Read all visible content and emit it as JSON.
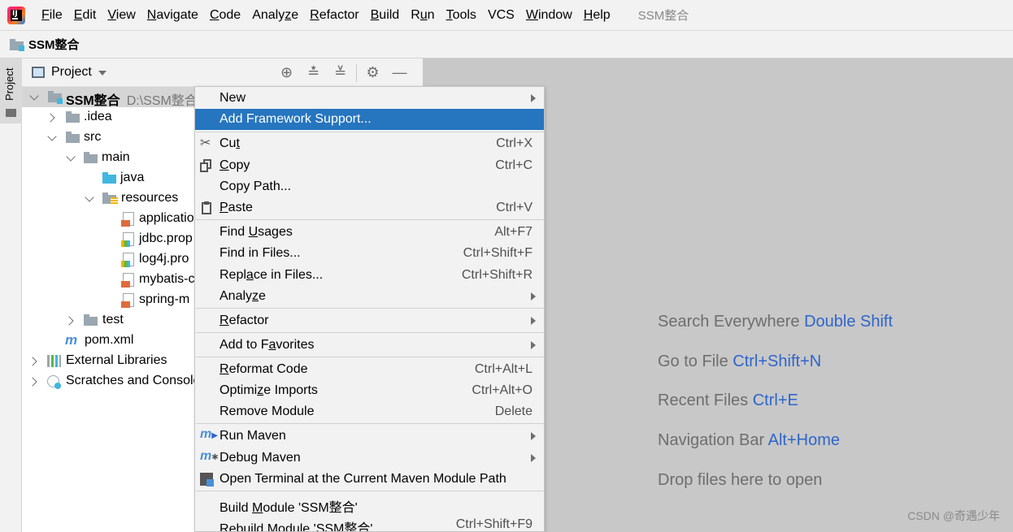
{
  "menubar": {
    "items": [
      "File",
      "Edit",
      "View",
      "Navigate",
      "Code",
      "Analyze",
      "Refactor",
      "Build",
      "Run",
      "Tools",
      "VCS",
      "Window",
      "Help"
    ],
    "title": "SSM整合"
  },
  "navbar": {
    "title": "SSM整合"
  },
  "sidestrip": {
    "tab_label": "Project"
  },
  "panel": {
    "title": "Project",
    "tree": [
      {
        "label": "SSM整合",
        "path": "D:\\SSM整合"
      },
      {
        "label": ".idea"
      },
      {
        "label": "src"
      },
      {
        "label": "main"
      },
      {
        "label": "java"
      },
      {
        "label": "resources"
      },
      {
        "label": "applicatio"
      },
      {
        "label": "jdbc.prop"
      },
      {
        "label": "log4j.pro"
      },
      {
        "label": "mybatis-c"
      },
      {
        "label": "spring-m"
      },
      {
        "label": "test"
      },
      {
        "label": "pom.xml"
      },
      {
        "label": "External Libraries"
      },
      {
        "label": "Scratches and Consoles"
      }
    ]
  },
  "context_menu": {
    "items": [
      {
        "label": "New",
        "shortcut": ""
      },
      {
        "label": "Add Framework Support...",
        "shortcut": ""
      },
      {
        "label": "Cut",
        "shortcut": "Ctrl+X"
      },
      {
        "label": "Copy",
        "shortcut": "Ctrl+C"
      },
      {
        "label": "Copy Path...",
        "shortcut": ""
      },
      {
        "label": "Paste",
        "shortcut": "Ctrl+V"
      },
      {
        "label": "Find Usages",
        "shortcut": "Alt+F7"
      },
      {
        "label": "Find in Files...",
        "shortcut": "Ctrl+Shift+F"
      },
      {
        "label": "Replace in Files...",
        "shortcut": "Ctrl+Shift+R"
      },
      {
        "label": "Analyze",
        "shortcut": ""
      },
      {
        "label": "Refactor",
        "shortcut": ""
      },
      {
        "label": "Add to Favorites",
        "shortcut": ""
      },
      {
        "label": "Reformat Code",
        "shortcut": "Ctrl+Alt+L"
      },
      {
        "label": "Optimize Imports",
        "shortcut": "Ctrl+Alt+O"
      },
      {
        "label": "Remove Module",
        "shortcut": "Delete"
      },
      {
        "label": "Run Maven",
        "shortcut": ""
      },
      {
        "label": "Debug Maven",
        "shortcut": ""
      },
      {
        "label": "Open Terminal at the Current Maven Module Path",
        "shortcut": ""
      },
      {
        "label": "Build Module 'SSM整合'",
        "shortcut": ""
      },
      {
        "label": "Rebuild Module 'SSM整合'",
        "shortcut": "Ctrl+Shift+F9"
      }
    ]
  },
  "editor_hints": [
    {
      "text": "Search Everywhere",
      "key": "Double Shift"
    },
    {
      "text": "Go to File",
      "key": "Ctrl+Shift+N"
    },
    {
      "text": "Recent Files",
      "key": "Ctrl+E"
    },
    {
      "text": "Navigation Bar",
      "key": "Alt+Home"
    },
    {
      "text": "Drop files here to open",
      "key": ""
    }
  ],
  "watermark": "CSDN @奇遇少年",
  "colors": {
    "highlight": "#2675bf",
    "hint_key": "#2f65ca",
    "folder": "#9aa7b0",
    "source_folder": "#40b6e0"
  }
}
